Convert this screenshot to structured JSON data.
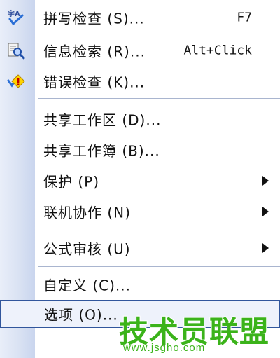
{
  "menu": {
    "items": [
      {
        "label": "拼写检查 (S)...",
        "shortcut": "F7",
        "icon": "spell-check-icon"
      },
      {
        "label": "信息检索 (R)...",
        "shortcut": "Alt+Click",
        "icon": "research-icon"
      },
      {
        "label": "错误检查 (K)...",
        "icon": "error-check-icon"
      },
      {
        "label": "共享工作区 (D)..."
      },
      {
        "label": "共享工作簿 (B)..."
      },
      {
        "label": "保护 (P)",
        "submenu": true
      },
      {
        "label": "联机协作 (N)",
        "submenu": true
      },
      {
        "label": "公式审核 (U)",
        "submenu": true
      },
      {
        "label": "自定义 (C)..."
      },
      {
        "label": "选项 (O)...",
        "highlighted": true
      }
    ]
  },
  "watermark": {
    "text": "技术员联盟",
    "url": "www.jsgho.com"
  },
  "colors": {
    "highlight_border": "#31569c",
    "gutter": "#d9e2f3",
    "watermark": "#3bb31a"
  }
}
